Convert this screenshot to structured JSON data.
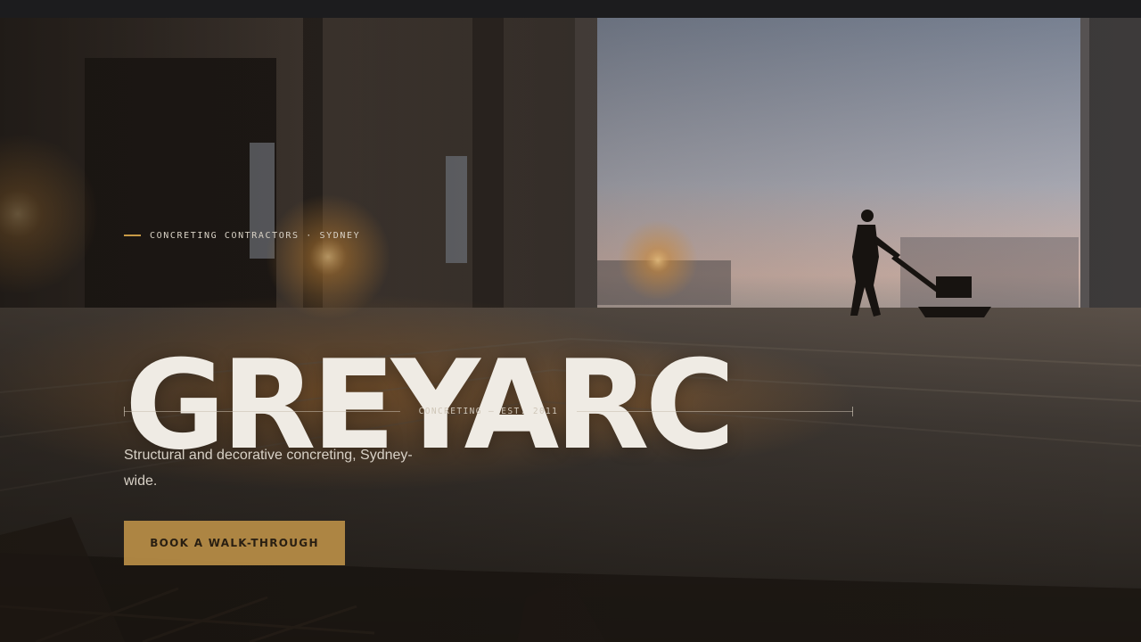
{
  "hero": {
    "eyebrow": "CONCRETING CONTRACTORS · SYDNEY",
    "brand": "GREYARC",
    "subline": "CONCRETING — EST. 2011",
    "tagline": "Structural and decorative concreting, Sydney-wide.",
    "cta_label": "BOOK A WALK-THROUGH"
  },
  "theme": {
    "accent": "#b98e47",
    "brand_text": "#efebe4",
    "overlay": "#1a1816"
  }
}
